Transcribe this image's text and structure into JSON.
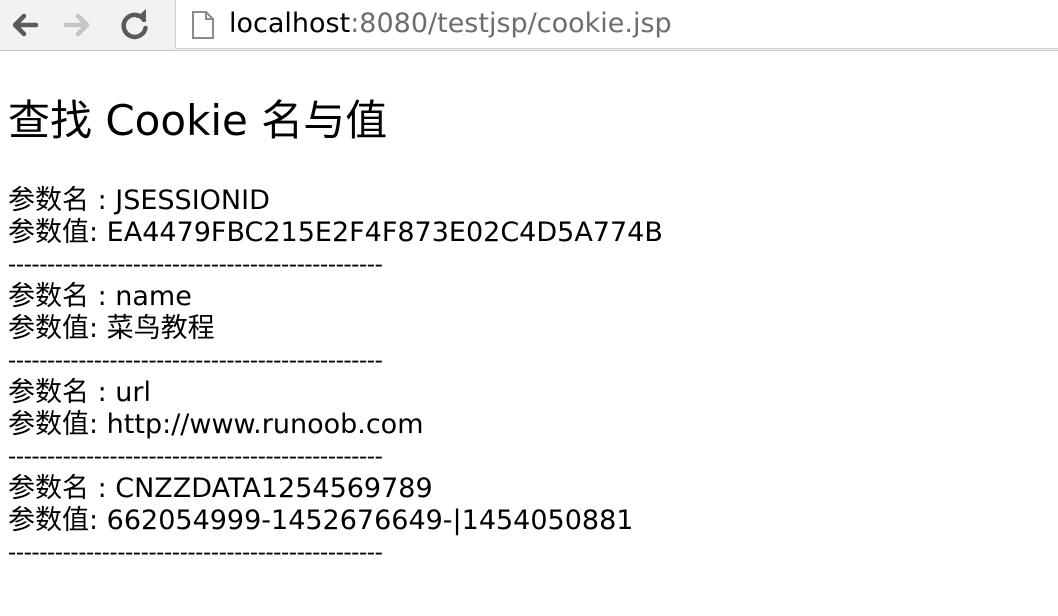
{
  "browser": {
    "url_host": "localhost",
    "url_rest": ":8080/testjsp/cookie.jsp",
    "icons": {
      "back": "back-arrow-icon",
      "forward": "forward-arrow-icon",
      "reload": "reload-icon",
      "page": "page-icon"
    }
  },
  "page": {
    "title": "查找 Cookie 名与值",
    "entries": [
      {
        "name_label": "参数名 : JSESSIONID",
        "value_label": "参数值: EA4479FBC215E2F4F873E02C4D5A774B",
        "separator": "------------------------------------------------"
      },
      {
        "name_label": "参数名 : name",
        "value_label": "参数值: 菜鸟教程",
        "separator": "------------------------------------------------"
      },
      {
        "name_label": "参数名 : url",
        "value_label": "参数值: http://www.runoob.com",
        "separator": "------------------------------------------------"
      },
      {
        "name_label": "参数名 : CNZZDATA1254569789",
        "value_label": "参数值: 662054999-1452676649-|1454050881",
        "separator": "------------------------------------------------"
      }
    ]
  },
  "colors": {
    "toolbar_bg": "#f2f2f2",
    "url_host": "#000000",
    "url_rest": "#6d6d6d",
    "nav_enabled": "#5a5a5a",
    "nav_disabled": "#c4c4c4"
  }
}
